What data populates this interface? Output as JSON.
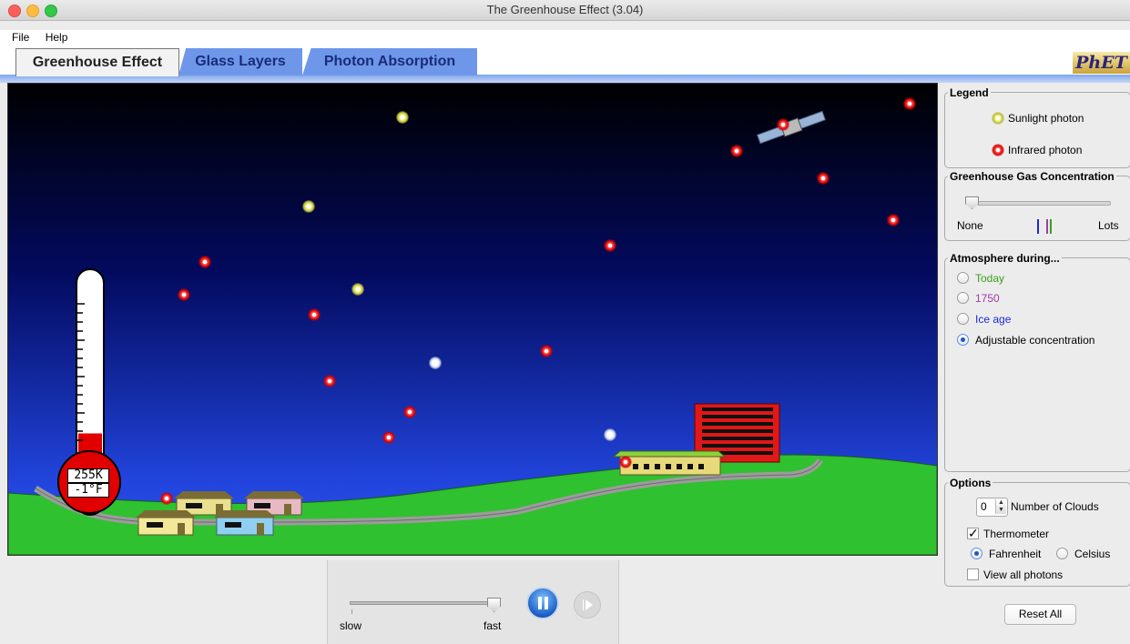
{
  "window": {
    "title": "The Greenhouse Effect (3.04)"
  },
  "menu": {
    "file": "File",
    "help": "Help"
  },
  "tabs": {
    "greenhouse": "Greenhouse Effect",
    "glass": "Glass Layers",
    "photon": "Photon Absorption"
  },
  "logo": "PhET",
  "thermometer": {
    "kelvin": "255K",
    "fahrenheit": "-1°F",
    "fill_level": 0.25
  },
  "legend": {
    "title": "Legend",
    "sunlight": "Sunlight photon",
    "infrared": "Infrared photon"
  },
  "concentration": {
    "title": "Greenhouse Gas Concentration",
    "min_label": "None",
    "max_label": "Lots",
    "value": 0.0
  },
  "atmosphere": {
    "title": "Atmosphere during...",
    "today": "Today",
    "y1750": "1750",
    "ice_age": "Ice age",
    "adjustable": "Adjustable concentration",
    "selected": "Adjustable concentration",
    "colors": {
      "today": "#3c9c1c",
      "y1750": "#a23aa8",
      "ice_age": "#1a2bd6"
    }
  },
  "options": {
    "title": "Options",
    "clouds_value": "0",
    "clouds_label": "Number of Clouds",
    "thermometer_label": "Thermometer",
    "thermometer_checked": true,
    "fahrenheit": "Fahrenheit",
    "celsius": "Celsius",
    "unit_selected": "Fahrenheit",
    "view_all_photons": "View all photons",
    "view_all_checked": false
  },
  "reset_button": "Reset All",
  "speed": {
    "slow": "slow",
    "fast": "fast",
    "value": 1.0
  },
  "colors": {
    "accent": "#2b63d8",
    "ground": "#2fc12f",
    "infrared": "#d80000",
    "sunlight": "#f2f47c"
  }
}
